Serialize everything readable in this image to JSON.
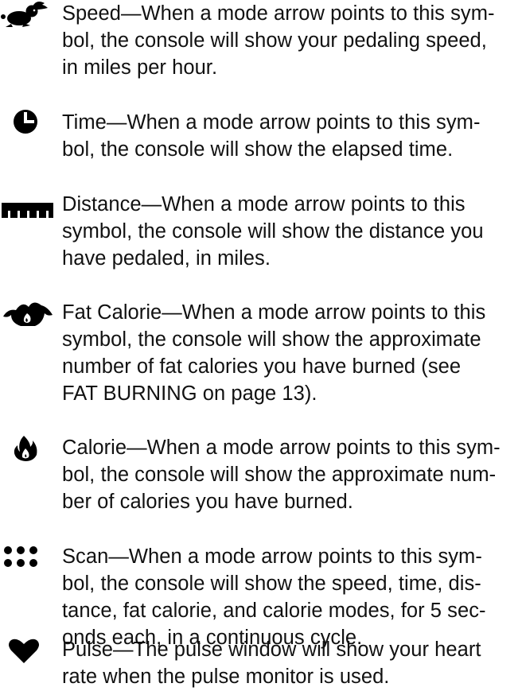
{
  "entries": [
    {
      "icon": "rabbit-icon",
      "lines": [
        "Speed—When a mode arrow points to this sym-",
        "bol, the console will show your pedaling speed,",
        "in miles per hour."
      ]
    },
    {
      "icon": "clock-icon",
      "lines": [
        "Time—When a mode arrow points to this sym-",
        "bol, the console will show the elapsed time."
      ]
    },
    {
      "icon": "ruler-icon",
      "lines": [
        "Distance—When a mode arrow points to this",
        "symbol, the console will show the distance you",
        "have pedaled, in miles."
      ]
    },
    {
      "icon": "flames-icon",
      "lines": [
        "Fat Calorie—When a mode arrow points to this",
        "symbol, the console will show the approximate",
        "number of fat calories you have burned (see",
        "FAT BURNING on page 13)."
      ]
    },
    {
      "icon": "flame-icon",
      "lines": [
        "Calorie—When a mode arrow points to this sym-",
        "bol, the console will show the approximate num-",
        "ber of calories you have burned."
      ]
    },
    {
      "icon": "scan-dots-icon",
      "lines": [
        "Scan—When a mode arrow points to this sym-",
        "bol, the console will show the speed, time, dis-",
        "tance, fat calorie, and calorie modes, for 5 sec-",
        "onds each, in a continuous cycle."
      ]
    },
    {
      "icon": "heart-icon",
      "lines": [
        "Pulse—The pulse window will show your heart",
        "rate when the pulse monitor is used."
      ]
    }
  ]
}
